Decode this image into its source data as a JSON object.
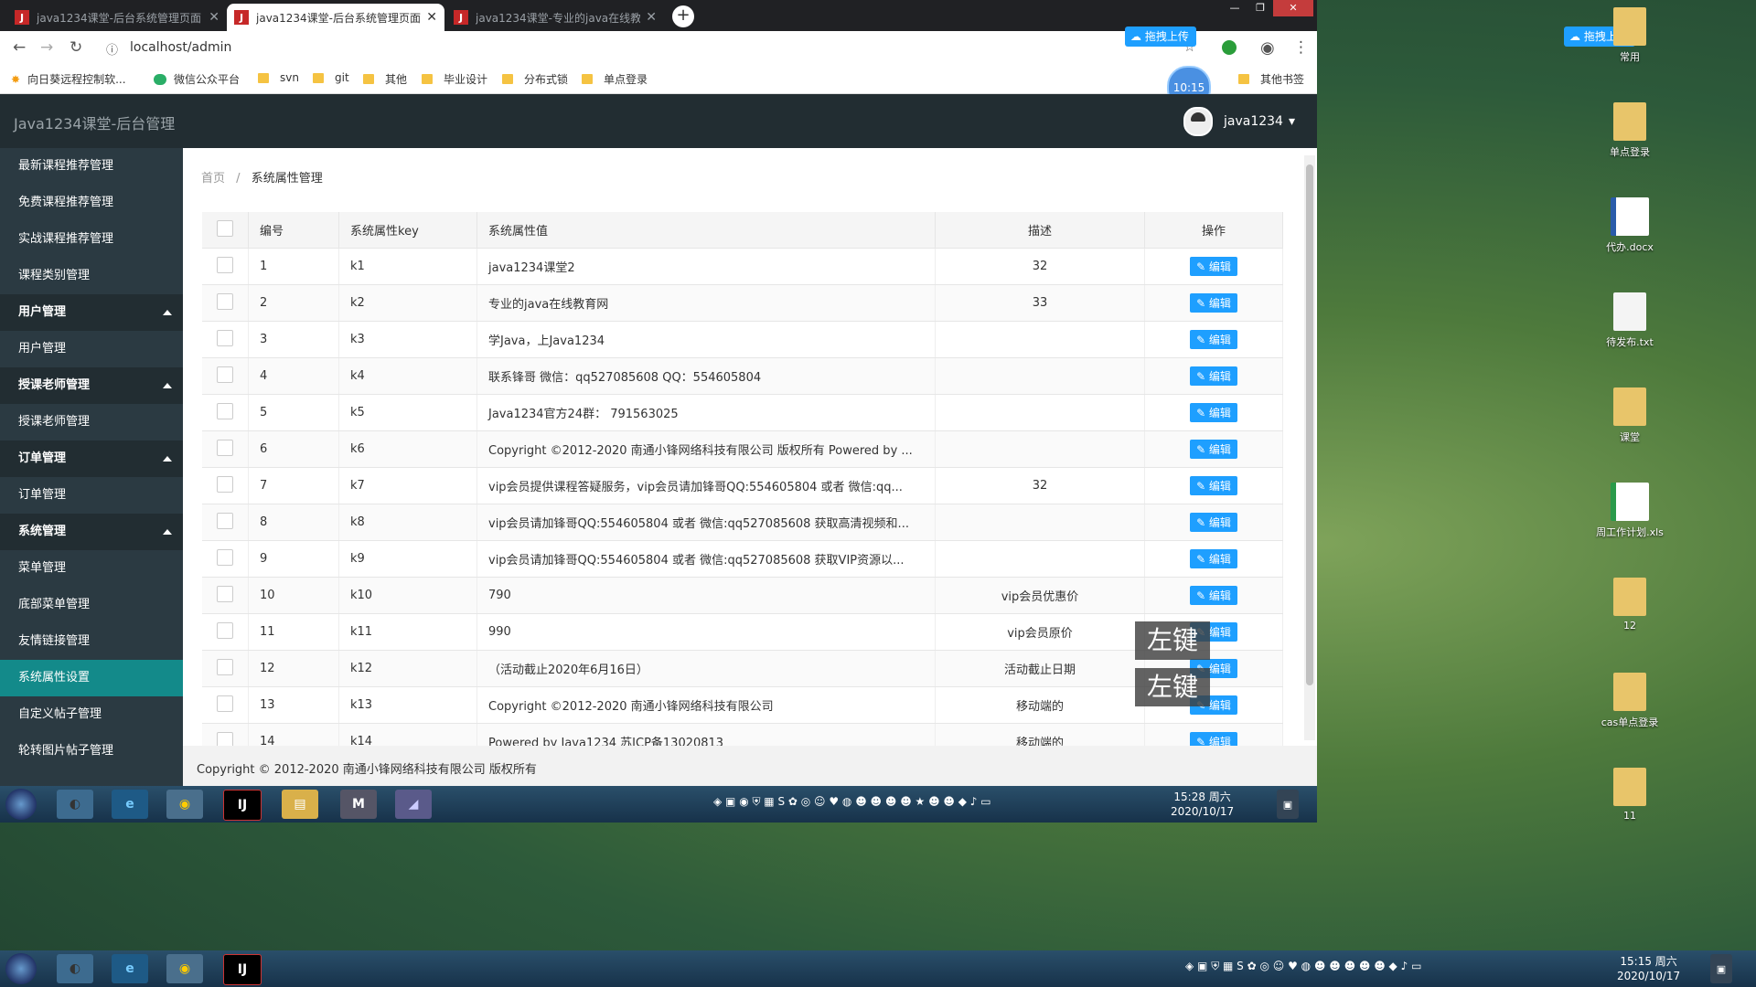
{
  "browser": {
    "tabs": [
      {
        "title": "java1234课堂-后台系统管理页面",
        "active": false
      },
      {
        "title": "java1234课堂-后台系统管理页面",
        "active": true
      },
      {
        "title": "java1234课堂-专业的java在线教育",
        "active": false
      }
    ],
    "new_tab": "+",
    "url": "localhost/admin",
    "bookmarks": [
      "向日葵远程控制软...",
      "微信公众平台",
      "svn",
      "git",
      "其他",
      "毕业设计",
      "分布式锁",
      "单点登录"
    ],
    "other_bookmarks": "其他书签",
    "timer_badge": "10:15",
    "upload_label": "拖拽上传"
  },
  "app": {
    "brand": "Java1234课堂-后台管理",
    "user": "java1234",
    "sidebar": [
      {
        "label": "最新课程推荐管理",
        "type": "item"
      },
      {
        "label": "免费课程推荐管理",
        "type": "item"
      },
      {
        "label": "实战课程推荐管理",
        "type": "item"
      },
      {
        "label": "课程类别管理",
        "type": "item"
      },
      {
        "label": "用户管理",
        "type": "group"
      },
      {
        "label": "用户管理",
        "type": "item"
      },
      {
        "label": "授课老师管理",
        "type": "group"
      },
      {
        "label": "授课老师管理",
        "type": "item"
      },
      {
        "label": "订单管理",
        "type": "group"
      },
      {
        "label": "订单管理",
        "type": "item"
      },
      {
        "label": "系统管理",
        "type": "group"
      },
      {
        "label": "菜单管理",
        "type": "item"
      },
      {
        "label": "底部菜单管理",
        "type": "item"
      },
      {
        "label": "友情链接管理",
        "type": "item"
      },
      {
        "label": "系统属性设置",
        "type": "active"
      },
      {
        "label": "自定义帖子管理",
        "type": "item"
      },
      {
        "label": "轮转图片帖子管理",
        "type": "item"
      }
    ],
    "breadcrumb": {
      "home": "首页",
      "sep": "/",
      "current": "系统属性管理"
    },
    "table": {
      "headers": [
        "编号",
        "系统属性key",
        "系统属性值",
        "描述",
        "操作"
      ],
      "edit_label": "✎ 编辑",
      "rows": [
        {
          "id": "1",
          "key": "k1",
          "value": "java1234课堂2",
          "desc": "32"
        },
        {
          "id": "2",
          "key": "k2",
          "value": "专业的java在线教育网",
          "desc": "33"
        },
        {
          "id": "3",
          "key": "k3",
          "value": "学Java，上Java1234",
          "desc": ""
        },
        {
          "id": "4",
          "key": "k4",
          "value": "联系锋哥 微信：qq527085608     QQ：554605804",
          "desc": ""
        },
        {
          "id": "5",
          "key": "k5",
          "value": " Java1234官方24群： 791563025",
          "desc": ""
        },
        {
          "id": "6",
          "key": "k6",
          "value": "Copyright ©2012-2020 南通小锋网络科技有限公司 版权所有 Powered by ...",
          "desc": ""
        },
        {
          "id": "7",
          "key": "k7",
          "value": "vip会员提供课程答疑服务，vip会员请加锋哥QQ:554605804 或者 微信:qq...",
          "desc": "32"
        },
        {
          "id": "8",
          "key": "k8",
          "value": "vip会员请加锋哥QQ:554605804 或者 微信:qq527085608 获取高清视频和...",
          "desc": ""
        },
        {
          "id": "9",
          "key": "k9",
          "value": "vip会员请加锋哥QQ:554605804 或者 微信:qq527085608 获取VIP资源以...",
          "desc": ""
        },
        {
          "id": "10",
          "key": "k10",
          "value": "790",
          "desc": "vip会员优惠价"
        },
        {
          "id": "11",
          "key": "k11",
          "value": "990",
          "desc": "vip会员原价"
        },
        {
          "id": "12",
          "key": "k12",
          "value": "（活动截止2020年6月16日）",
          "desc": "活动截止日期"
        },
        {
          "id": "13",
          "key": "k13",
          "value": "Copyright ©2012-2020 南通小锋网络科技有限公司",
          "desc": "移动端的"
        },
        {
          "id": "14",
          "key": "k14",
          "value": "Powered by Java1234 苏ICP备13020813",
          "desc": "移动端的"
        }
      ]
    },
    "footer": "Copyright © 2012-2020 南通小锋网络科技有限公司 版权所有"
  },
  "overlay": {
    "key_hint": "左键"
  },
  "taskbar": {
    "time": "15:28 周六",
    "date": "2020/10/17",
    "bottom_time": "15:15 周六",
    "bottom_date": "2020/10/17"
  },
  "desktop": {
    "icons": [
      "常用",
      "单点登录",
      "代办.docx",
      "待发布.txt",
      "课堂",
      "周工作计划.xls",
      "12",
      "cas单点登录",
      "11"
    ]
  }
}
